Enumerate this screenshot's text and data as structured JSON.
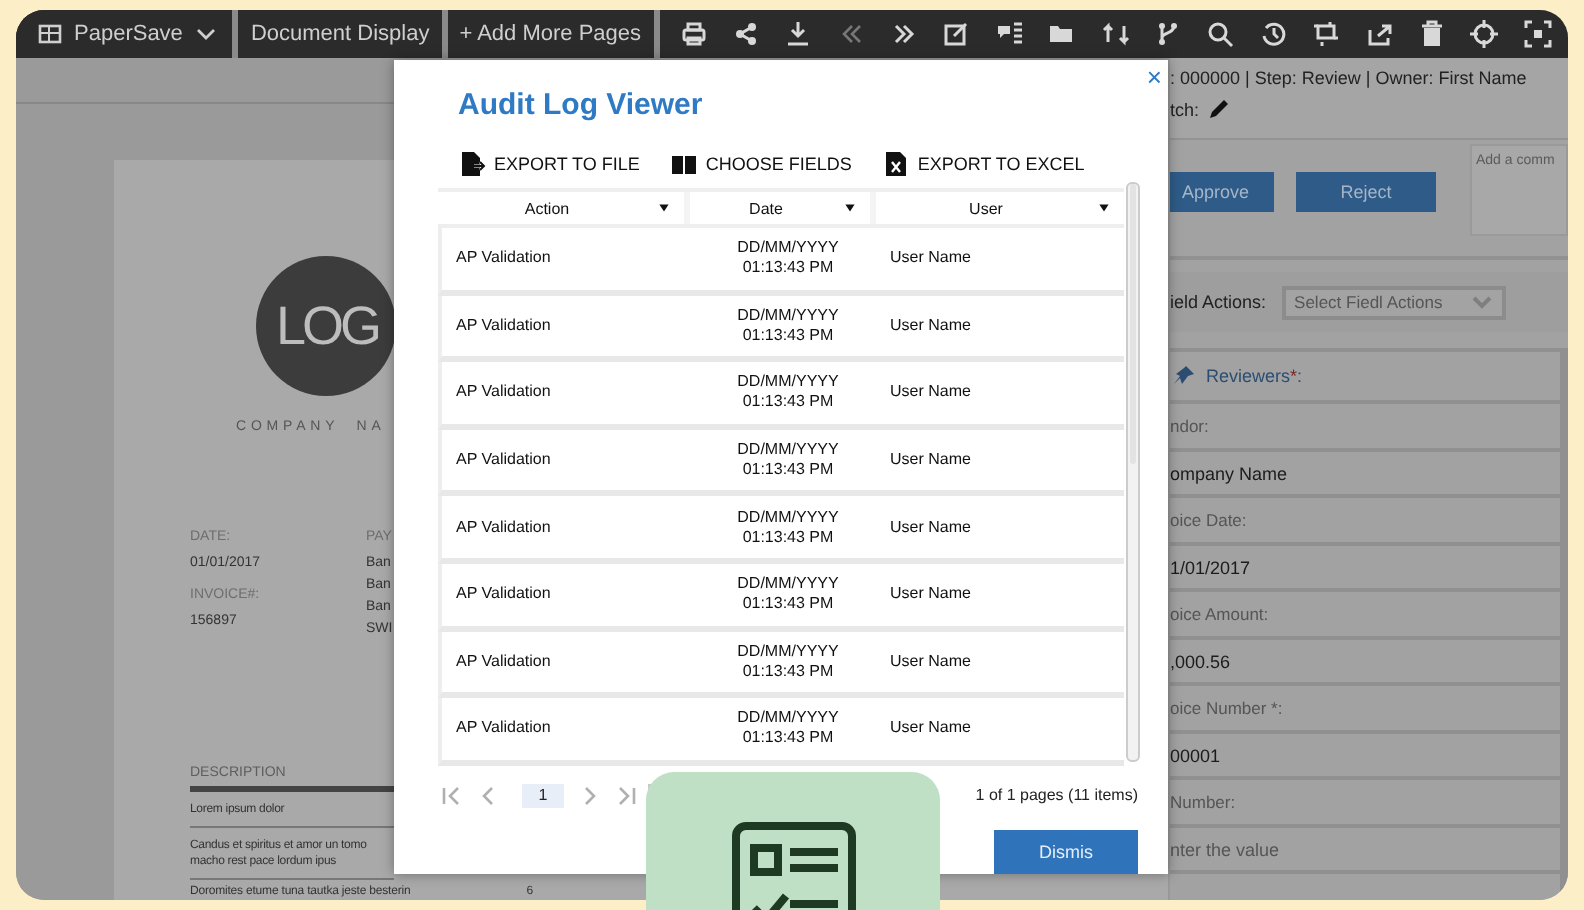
{
  "toolbar": {
    "app_menu": "PaperSave",
    "buttons": [
      "Document Display",
      "+ Add More Pages"
    ]
  },
  "document": {
    "logo": "LOG",
    "company": "COMPANY  NA",
    "details": [
      {
        "label": "DATE:",
        "value": "01/01/2017"
      },
      {
        "label": "INVOICE#:",
        "value": "156897"
      }
    ],
    "payment": {
      "label": "PAY",
      "lines": [
        "Ban",
        "Ban",
        "Ban",
        "SWI"
      ]
    },
    "description": "DESCRIPTION",
    "items": [
      "Lorem ipsum dolor",
      "Candus et spiritus et amor un tomo\nmacho rest pace lordum ipus",
      "Doromites etume tuna tautka jeste besterin"
    ],
    "last_qty": "6"
  },
  "record": {
    "info": ": 000000 | Step: Review | Owner: First Name",
    "batch_label": "tch:",
    "comment_placeholder": "Add a comm",
    "actions": [
      "Approve",
      "Reject"
    ],
    "field_actions_label": "ield Actions:",
    "field_actions_placeholder": "Select Fiedl Actions",
    "reviewers": {
      "label": "Reviewers",
      "mark": "*",
      "suffix": ":"
    },
    "fields": [
      {
        "label": "ndor:",
        "value": "ompany Name"
      },
      {
        "label": "oice Date:",
        "value": "1/01/2017"
      },
      {
        "label": "oice Amount:",
        "value": ",000.56"
      },
      {
        "label": "oice Number *:",
        "value": "00001"
      },
      {
        "label": "Number:",
        "placeholder": "nter the value"
      }
    ]
  },
  "dialog": {
    "title": "Audit Log Viewer",
    "close": "×",
    "tools": [
      {
        "label": "EXPORT TO FILE",
        "kind": "file"
      },
      {
        "label": "CHOOSE FIELDS",
        "kind": "book"
      },
      {
        "label": "EXPORT TO EXCEL",
        "kind": "excel"
      }
    ],
    "columns": [
      "Action",
      "Date",
      "User"
    ],
    "rows": [
      {
        "action": "AP Validation",
        "date": "DD/MM/YYYY\n01:13:43 PM",
        "user": "User Name"
      },
      {
        "action": "AP Validation",
        "date": "DD/MM/YYYY\n01:13:43 PM",
        "user": "User Name"
      },
      {
        "action": "AP Validation",
        "date": "DD/MM/YYYY\n01:13:43 PM",
        "user": "User Name"
      },
      {
        "action": "AP Validation",
        "date": "DD/MM/YYYY\n01:13:43 PM",
        "user": "User Name"
      },
      {
        "action": "AP Validation",
        "date": "DD/MM/YYYY\n01:13:43 PM",
        "user": "User Name"
      },
      {
        "action": "AP Validation",
        "date": "DD/MM/YYYY\n01:13:43 PM",
        "user": "User Name"
      },
      {
        "action": "AP Validation",
        "date": "DD/MM/YYYY\n01:13:43 PM",
        "user": "User Name"
      },
      {
        "action": "AP Validation",
        "date": "DD/MM/YYYY\n01:13:43 PM",
        "user": "User Name"
      }
    ],
    "pager": {
      "page": "1",
      "summary": "1 of 1 pages (11 items)"
    },
    "button": "Dismis"
  }
}
